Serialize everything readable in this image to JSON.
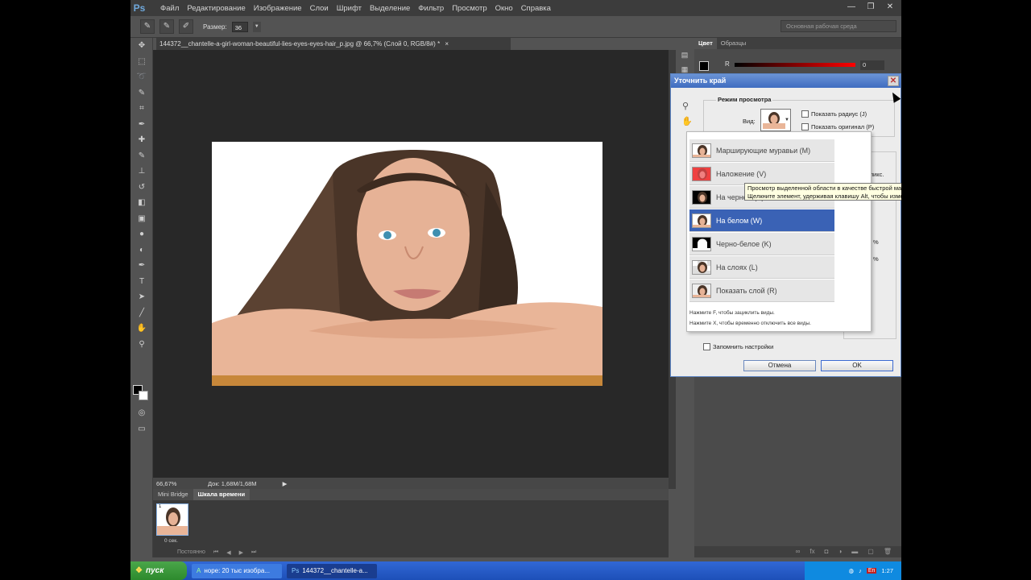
{
  "app": {
    "logo": "Ps"
  },
  "menu": [
    "Файл",
    "Редактирование",
    "Изображение",
    "Слои",
    "Шрифт",
    "Выделение",
    "Фильтр",
    "Просмотр",
    "Окно",
    "Справка"
  ],
  "window_controls": {
    "minimize": "—",
    "restore": "❐",
    "close": "✕"
  },
  "options_bar": {
    "size_label": "Размер:",
    "size_value": "36",
    "workspace": "Основная рабочая среда"
  },
  "document": {
    "tab_title": "144372__chantelle-a-girl-woman-beautiful-lies-eyes-eyes-hair_p.jpg @ 66,7% (Слой 0, RGB/8#) *",
    "close": "×"
  },
  "status_bar": {
    "zoom": "66,67%",
    "doc_info": "Док: 1,68M/1,68M",
    "arrow": "▶"
  },
  "timeline": {
    "tabs": [
      "Mini Bridge",
      "Шкала времени"
    ],
    "frame_number": "1",
    "frame_time": "0 сек.",
    "loop": "Постоянно",
    "controls": [
      "⏮",
      "◀",
      "▶",
      "⏭"
    ]
  },
  "panels": {
    "tabs": [
      "Цвет",
      "Образцы"
    ],
    "r_label": "R",
    "r_value": "0"
  },
  "dialog": {
    "title": "Уточнить край",
    "close": "✕",
    "preview_group": "Режим просмотра",
    "view_label": "Вид:",
    "show_radius": "Показать радиус (J)",
    "show_original": "Показать оригинал (P)",
    "partial_1": "пикс.",
    "partial_2": "%",
    "partial_3": "%",
    "remember": "Запомнить настройки",
    "cancel": "Отмена",
    "ok": "OK"
  },
  "view_options": [
    {
      "label": "Марширующие муравьи (M)",
      "thumb": "marching-ants"
    },
    {
      "label": "Наложение (V)",
      "thumb": "overlay"
    },
    {
      "label": "На черном (B)",
      "thumb": "on-black"
    },
    {
      "label": "На белом (W)",
      "thumb": "on-white",
      "selected": true
    },
    {
      "label": "Черно-белое (K)",
      "thumb": "black-white"
    },
    {
      "label": "На слоях (L)",
      "thumb": "on-layers"
    },
    {
      "label": "Показать слой (R)",
      "thumb": "reveal-layer"
    }
  ],
  "popup_hints": [
    "Нажмите F, чтобы зациклить виды.",
    "Нажмите X, чтобы временно отключить все виды."
  ],
  "tooltip": {
    "line1": "Просмотр выделенной области в качестве быстрой маски.",
    "line2": "Щелкните элемент, удерживая клавишу Alt, чтобы изменить параметры быстрой маски."
  },
  "taskbar": {
    "start": "пуск",
    "tasks": [
      {
        "label": "норе: 20 тыс изобра..."
      },
      {
        "label": "144372__chantelle-a..."
      }
    ],
    "lang": "En",
    "clock": "1:27"
  },
  "colors": {
    "accent": "#3a62b5",
    "panel_bg": "#535353",
    "canvas_bg": "#282828",
    "taskbar": "#2b5fd0",
    "start": "#3a9a3a"
  }
}
